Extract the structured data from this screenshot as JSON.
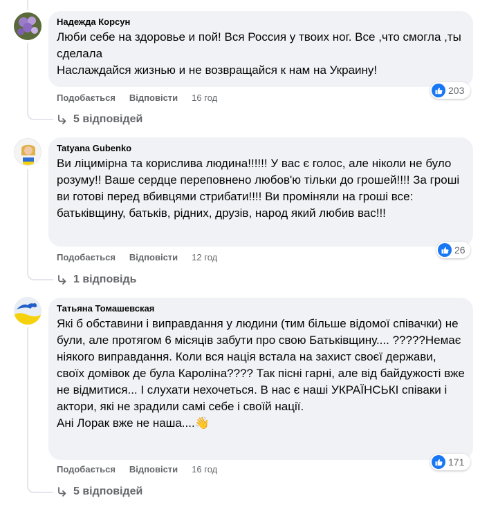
{
  "comments": [
    {
      "author": "Надежда Корсун",
      "text": "Люби себе на здоровье и пой! Вся Россия у твоих ног. Все ,что смогла ,ты сделала\nНаслаждайся жизнью и не возвращайся к нам на Украину!",
      "like_label": "Подобається",
      "reply_label": "Відповісти",
      "time": "16 год",
      "reaction_count": "203",
      "replies_label": "5 відповідей"
    },
    {
      "author": "Tatyana Gubenko",
      "text": "Ви ліцимірна та корислива людина!!!!!! У вас є голос, але ніколи не було розуму!! Ваше сердце переповнено любов'ю тільки до грошей!!!! За гроші ви готові перед вбивцями стрибати!!!! Ви проміняли на гроші все: батьківщину, батьків, рідних, друзів, народ який любив вас!!!",
      "like_label": "Подобається",
      "reply_label": "Відповісти",
      "time": "12 год",
      "reaction_count": "26",
      "replies_label": "1 відповідь"
    },
    {
      "author": "Татьяна Томашевская",
      "text": "Які б обставини і виправдання у людини (тим більше відомої співачки) не були, але протягом 6 місяців забути про свою Батьківщину.... ?????Немає ніякого виправдання. Коли вся нація встала на захист своєї держави, своїх домівок де була Кароліна???? Так пісні гарні, але від байдужості вже не відмитися... І слухати нехочеться. В нас є наші УКРАЇНСЬКІ співаки і актори, які не зрадили самі себе і своїй нації.\nАні Лорак вже не наша....",
      "emoji": "👋",
      "like_label": "Подобається",
      "reply_label": "Відповісти",
      "time": "16 год",
      "reaction_count": "171",
      "replies_label": "5 відповідей"
    }
  ],
  "colors": {
    "bubble": "#f0f2f5",
    "like_blue": "#1877f2",
    "secondary_text": "#65676b",
    "thread_line": "#e4e6eb"
  }
}
